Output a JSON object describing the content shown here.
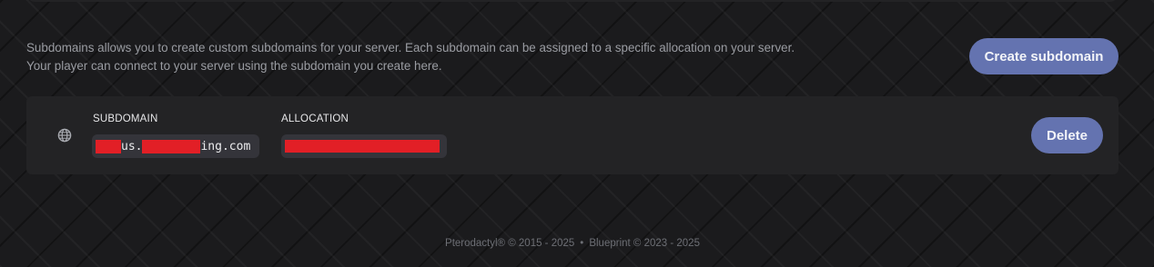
{
  "description": {
    "line1": "Subdomains allows you to create custom subdomains for your server. Each subdomain can be assigned to a specific allocation on your server.",
    "line2": "Your player can connect to your server using the subdomain you create here."
  },
  "actions": {
    "create_label": "Create subdomain"
  },
  "subdomain_entry": {
    "icon": "globe-icon",
    "subdomain_label": "SUBDOMAIN",
    "subdomain_visible_parts": [
      "us.",
      "ing.com"
    ],
    "allocation_label": "ALLOCATION",
    "delete_label": "Delete"
  },
  "footer": {
    "pterodactyl": "Pterodactyl® © 2015 - 2025",
    "separator": "•",
    "blueprint": "Blueprint © 2023 - 2025"
  },
  "colors": {
    "background": "#1b1b1d",
    "card": "#232325",
    "code_box": "#34343a",
    "accent_button": "#6473b0",
    "redaction": "#e21f26",
    "muted_text": "#9a9ca2"
  }
}
